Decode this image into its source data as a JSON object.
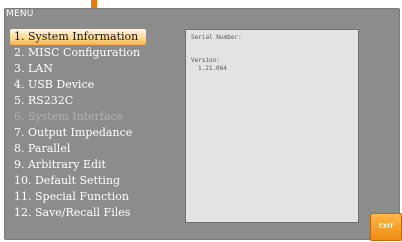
{
  "menu": {
    "title": "MENU",
    "selected_index": 0,
    "items": [
      {
        "label": "1. System Information",
        "state": "selected"
      },
      {
        "label": "2. MISC Configuration",
        "state": "normal"
      },
      {
        "label": "3. LAN",
        "state": "normal"
      },
      {
        "label": "4. USB Device",
        "state": "normal"
      },
      {
        "label": "5. RS232C",
        "state": "normal"
      },
      {
        "label": "6. System Interface",
        "state": "disabled"
      },
      {
        "label": "7. Output Impedance",
        "state": "normal"
      },
      {
        "label": "8. Parallel",
        "state": "normal"
      },
      {
        "label": "9. Arbitrary Edit",
        "state": "normal"
      },
      {
        "label": "10. Default Setting",
        "state": "normal"
      },
      {
        "label": "11. Special Function",
        "state": "normal"
      },
      {
        "label": "12. Save/Recall Files",
        "state": "normal"
      }
    ]
  },
  "info": {
    "serial_label": "Serial Number:",
    "serial_value": "",
    "version_label": "Version:",
    "version_value": "1.21.064"
  },
  "softkeys": {
    "exit_label": "EXIT"
  },
  "colors": {
    "panel_background": "#8c8c8c",
    "selected_highlight": "#ffd68a",
    "exit_button": "#f08c10",
    "indicator": "#e87a12"
  }
}
